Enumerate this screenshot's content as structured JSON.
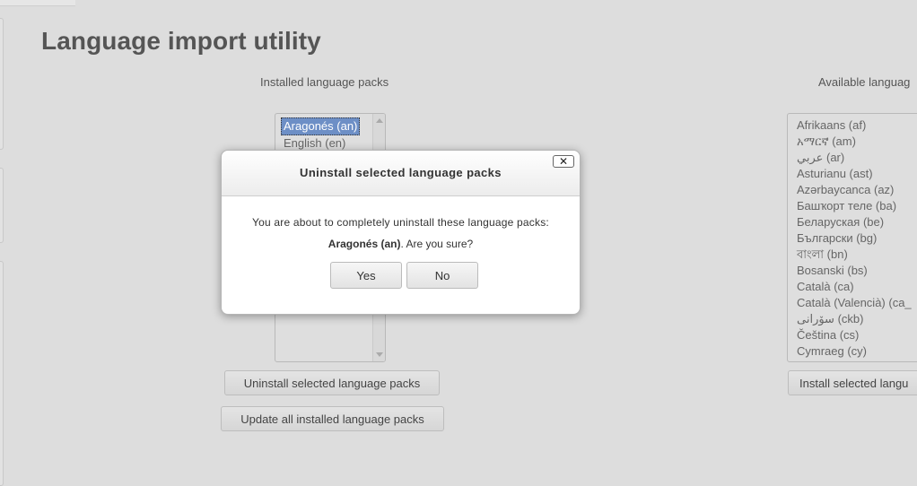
{
  "page": {
    "title": "Language import utility"
  },
  "installed": {
    "heading": "Installed language packs",
    "options": [
      "Aragonés (an)",
      "English (en)"
    ],
    "uninstall_label": "Uninstall selected language packs",
    "update_label": "Update all installed language packs"
  },
  "available": {
    "heading": "Available languag",
    "options": [
      "Afrikaans (af)",
      "አማርኛ (am)",
      "عربي (ar)",
      "Asturianu (ast)",
      "Azərbaycanca (az)",
      "Башҡорт теле (ba)",
      "Беларуская (be)",
      "Български (bg)",
      "বাংলা (bn)",
      "Bosanski (bs)",
      "Català (ca)",
      "Català (Valencià) (ca_",
      "سۆرانی (ckb)",
      "Čeština (cs)",
      "Cymraeg (cy)"
    ],
    "install_label": "Install selected langu"
  },
  "dialog": {
    "title": "Uninstall selected language packs",
    "close_glyph": "✕",
    "message": "You are about to completely uninstall these language packs:",
    "target": "Aragonés (an)",
    "question": ". Are you sure?",
    "yes_label": "Yes",
    "no_label": "No"
  },
  "colors": {
    "selected": "#6d8fc6",
    "background": "#dddddd"
  }
}
